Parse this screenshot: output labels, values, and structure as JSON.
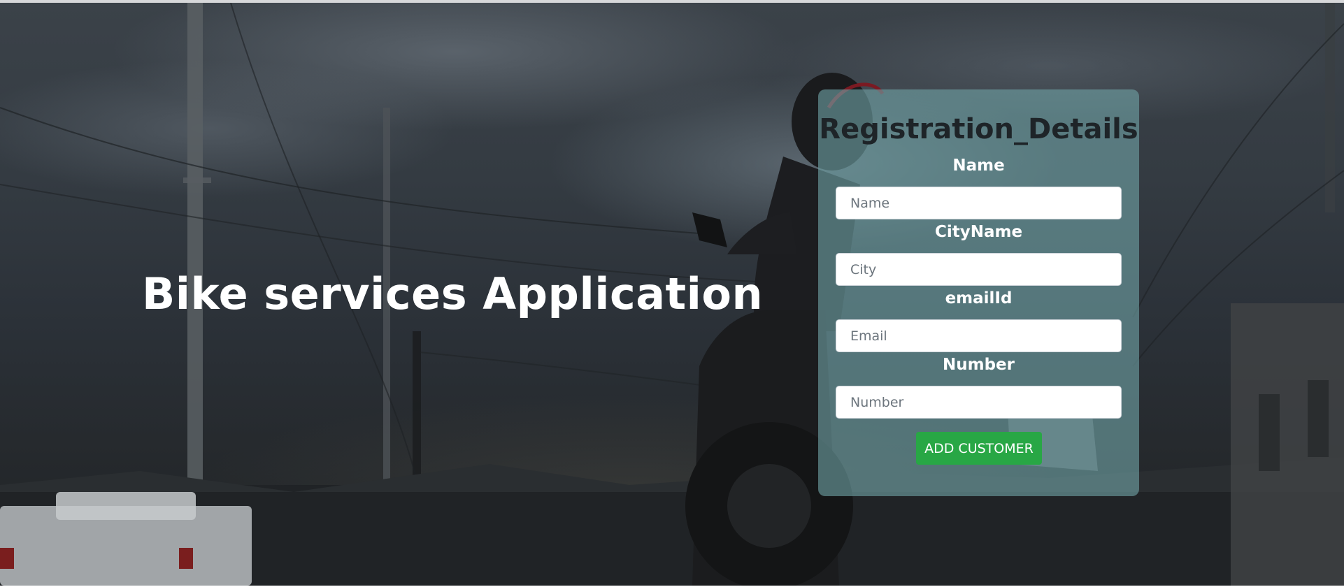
{
  "hero": {
    "headline": "Bike services Application"
  },
  "form": {
    "title": "Registration_Details",
    "fields": [
      {
        "label": "Name",
        "placeholder": "Name",
        "value": ""
      },
      {
        "label": "CityName",
        "placeholder": "City",
        "value": ""
      },
      {
        "label": "emailId",
        "placeholder": "Email",
        "value": ""
      },
      {
        "label": "Number",
        "placeholder": "Number",
        "value": ""
      }
    ],
    "submit_label": "ADD CUSTOMER"
  },
  "colors": {
    "card_background": "#6fa2a4",
    "button_green": "#28a745",
    "title_text": "#1e2428",
    "label_text": "#ffffff"
  }
}
